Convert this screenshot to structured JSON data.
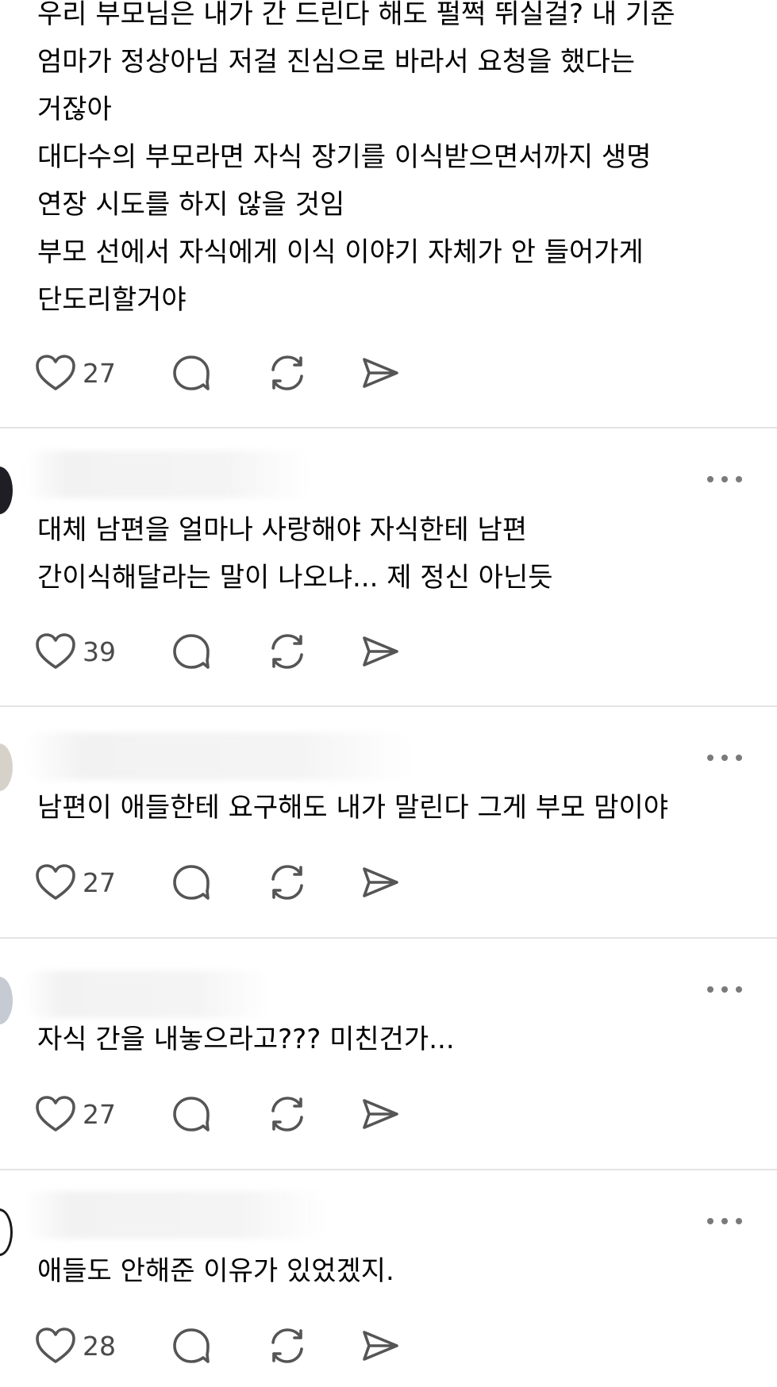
{
  "colors": {
    "icon_stroke": "#555555",
    "count_text": "#4a4a4a",
    "divider": "#e3e3e3",
    "more_dots": "#7a7a7a"
  },
  "icons": {
    "like": "heart-icon",
    "comment": "comment-bubble-icon",
    "repost": "repost-icon",
    "share": "send-arrow-icon",
    "more": "ellipsis-icon"
  },
  "posts": [
    {
      "text": "우리 부모님은 내가 간 드린다 해도 펄쩍 뛰실걸? 내 기준\n엄마가 정상아님 저걸 진심으로 바라서 요청을 했다는\n거잖아\n대다수의 부모라면 자식 장기를 이식받으면서까지 생명\n연장 시도를 하지 않을 것임\n부모 선에서 자식에게 이식 이야기 자체가 안 들어가게\n단도리할거야",
      "likes": "27"
    },
    {
      "text": "대체 남편을 얼마나 사랑해야 자식한테 남편\n간이식해달라는 말이 나오냐... 제 정신 아닌듯",
      "likes": "39"
    },
    {
      "text": "남편이 애들한테 요구해도 내가 말린다 그게 부모 맘이야",
      "likes": "27"
    },
    {
      "text": "자식 간을 내놓으라고??? 미친건가...",
      "likes": "27"
    },
    {
      "text": "애들도 안해준 이유가 있었겠지.",
      "likes": "28"
    }
  ]
}
